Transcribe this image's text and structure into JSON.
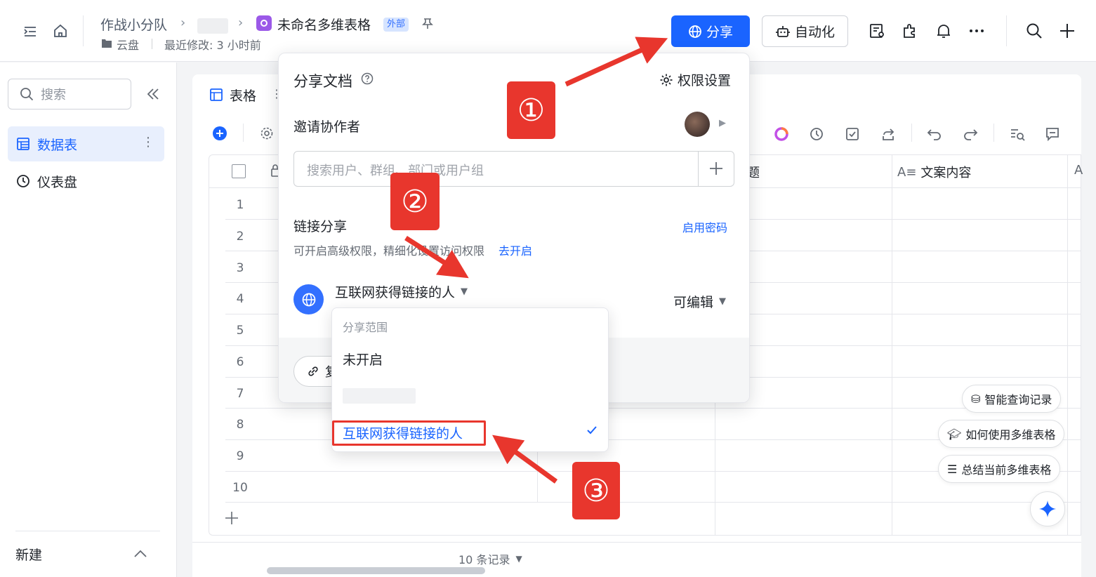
{
  "topbar": {
    "breadcrumb_team": "作战小分队",
    "doc_title": "未命名多维表格",
    "external_badge": "外部",
    "location": "云盘",
    "last_modified": "最近修改: 3 小时前",
    "share_label": "分享",
    "automation_label": "自动化"
  },
  "sidebar": {
    "search_placeholder": "搜索",
    "items": [
      {
        "label": "数据表",
        "icon": "table-icon",
        "active": true
      },
      {
        "label": "仪表盘",
        "icon": "dashboard-icon",
        "active": false
      }
    ],
    "new_label": "新建"
  },
  "main": {
    "tab_label": "表格",
    "columns": [
      "题",
      "文案内容"
    ],
    "rows": [
      "1",
      "2",
      "3",
      "4",
      "5",
      "6",
      "7",
      "8",
      "9",
      "10"
    ],
    "record_count": "10 条记录",
    "float_buttons": [
      "智能查询记录",
      "如何使用多维表格",
      "总结当前多维表格"
    ]
  },
  "share_popup": {
    "title": "分享文档",
    "permission_settings": "权限设置",
    "invite_label": "邀请协作者",
    "search_placeholder": "搜索用户、群组、部门或用户组",
    "link_share_label": "链接分享",
    "enable_password": "启用密码",
    "advanced_hint": "可开启高级权限，精细化设置访问权限",
    "go_enable": "去开启",
    "scope_value": "互联网获得链接的人",
    "permission_value": "可编辑",
    "copy_label": "复"
  },
  "scope_dropdown": {
    "header": "分享范围",
    "options": [
      "未开启",
      "互联网获得链接的人"
    ],
    "selected": "互联网获得链接的人"
  },
  "annotations": {
    "step1": "①",
    "step2": "②",
    "step3": "③"
  },
  "colors": {
    "primary": "#1a64ff",
    "annotation_red": "#e8362d"
  }
}
